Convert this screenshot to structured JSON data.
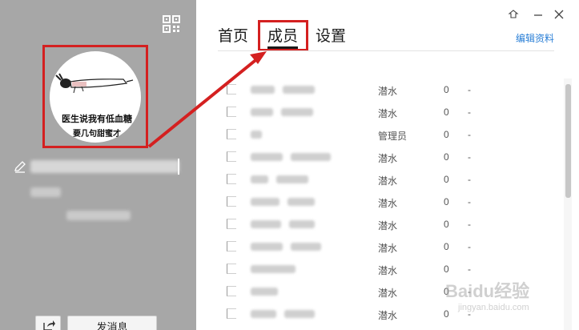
{
  "left_panel": {
    "avatar_text_line1": "医生说我有低血糖",
    "avatar_text_line2": "要几句甜蜜才",
    "send_message_label": "发消息"
  },
  "tabs": [
    {
      "label": "首页"
    },
    {
      "label": "成员"
    },
    {
      "label": "设置"
    }
  ],
  "active_tab": "成员",
  "edit_profile_label": "编辑资料",
  "members": [
    {
      "role": "潜水",
      "points": "0",
      "extra": "-"
    },
    {
      "role": "潜水",
      "points": "0",
      "extra": "-"
    },
    {
      "role": "管理员",
      "points": "0",
      "extra": "-"
    },
    {
      "role": "潜水",
      "points": "0",
      "extra": "-"
    },
    {
      "role": "潜水",
      "points": "0",
      "extra": "-"
    },
    {
      "role": "潜水",
      "points": "0",
      "extra": "-"
    },
    {
      "role": "潜水",
      "points": "0",
      "extra": "-"
    },
    {
      "role": "潜水",
      "points": "0",
      "extra": "-"
    },
    {
      "role": "潜水",
      "points": "0",
      "extra": "-"
    },
    {
      "role": "潜水",
      "points": "0",
      "extra": "-"
    },
    {
      "role": "潜水",
      "points": "0",
      "extra": "-"
    }
  ],
  "watermark": {
    "main": "Baidu经验",
    "sub": "jingyan.baidu.com"
  },
  "icons": [
    "qr-code-icon",
    "pencil-icon",
    "share-icon",
    "skin-icon",
    "minimize-icon",
    "close-icon"
  ],
  "colors": {
    "highlight_red": "#d42020",
    "link_blue": "#2a7fd6",
    "left_panel_gray": "#a7a7a7"
  }
}
